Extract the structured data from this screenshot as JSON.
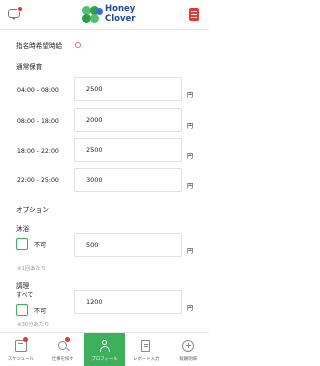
{
  "header": {
    "logo_line1": "Honey",
    "logo_line2": "Clover"
  },
  "section": {
    "title": "指名時希望時給",
    "regular_title": "通常保育"
  },
  "time_rates": [
    {
      "time": "04:00 - 08:00",
      "value": "2500",
      "unit": "円"
    },
    {
      "time": "08:00 - 18:00",
      "value": "2000",
      "unit": "円"
    },
    {
      "time": "18:00 - 22:00",
      "value": "2500",
      "unit": "円"
    },
    {
      "time": "22:00 - 25:00",
      "value": "3000",
      "unit": "円"
    }
  ],
  "options": {
    "title": "オプション",
    "bath": {
      "label": "沐浴",
      "not_available": "不可",
      "value": "500",
      "unit": "円",
      "note": "※1回あたり"
    },
    "cooking": {
      "label": "調理",
      "sublabel": "すべて",
      "not_available": "不可",
      "value": "1200",
      "unit": "円",
      "note": "※30分あたり"
    }
  },
  "nav": [
    {
      "label": "スケジュール"
    },
    {
      "label": "仕事を探す"
    },
    {
      "label": "プロフィール"
    },
    {
      "label": "レポート入力"
    },
    {
      "label": "報酬明細"
    }
  ],
  "colors": {
    "accent": "#3cb05b",
    "notification": "#e53935",
    "logo_blue": "#1f4aa8"
  }
}
